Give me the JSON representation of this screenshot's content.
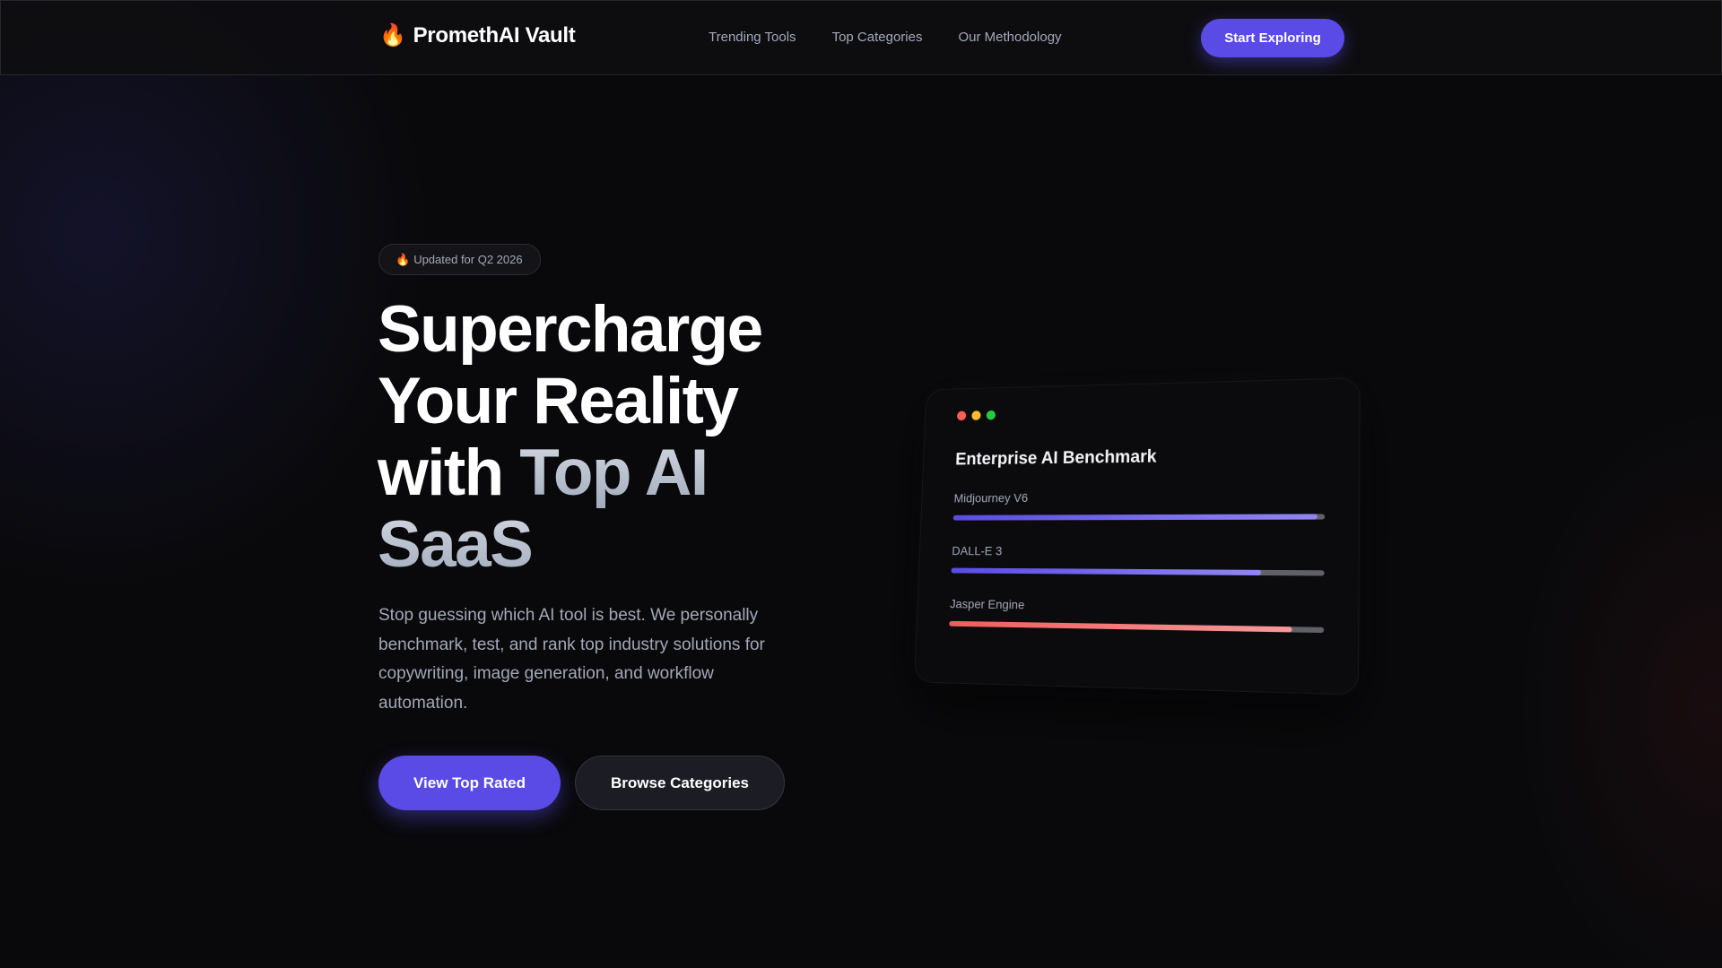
{
  "nav": {
    "brand": "PromethAI Vault",
    "brand_icon": "flame-icon",
    "links": [
      "Trending Tools",
      "Top Categories",
      "Our Methodology"
    ],
    "cta_label": "Start Exploring"
  },
  "hero": {
    "badge": "Updated for Q2 2026",
    "badge_icon": "flame-icon",
    "headline_plain_1": "Supercharge",
    "headline_plain_2": "Your Reality",
    "headline_plain_3": "with ",
    "headline_accent_1": "Top AI",
    "headline_accent_2": "SaaS",
    "description": "Stop guessing which AI tool is best. We personally benchmark, test, and rank top industry solutions for copywriting, image generation, and workflow automation.",
    "primary_button": "View Top Rated",
    "secondary_button": "Browse Categories"
  },
  "benchmark": {
    "title": "Enterprise AI Benchmark",
    "window_dots": [
      "#ff5f57",
      "#febc2e",
      "#28c840"
    ],
    "items": [
      {
        "name": "Midjourney V6",
        "score_pct": 98,
        "color_start": "#5b4be6",
        "color_end": "#8f86f0"
      },
      {
        "name": "DALL-E 3",
        "score_pct": 84,
        "color_start": "#5b4be6",
        "color_end": "#8f86f0"
      },
      {
        "name": "Jasper Engine",
        "score_pct": 92,
        "color_start": "#f15b5b",
        "color_end": "#f79a9a"
      }
    ]
  },
  "colors": {
    "background": "#09090b",
    "accent": "#5b4be6",
    "muted_text": "#a3a9b8"
  }
}
